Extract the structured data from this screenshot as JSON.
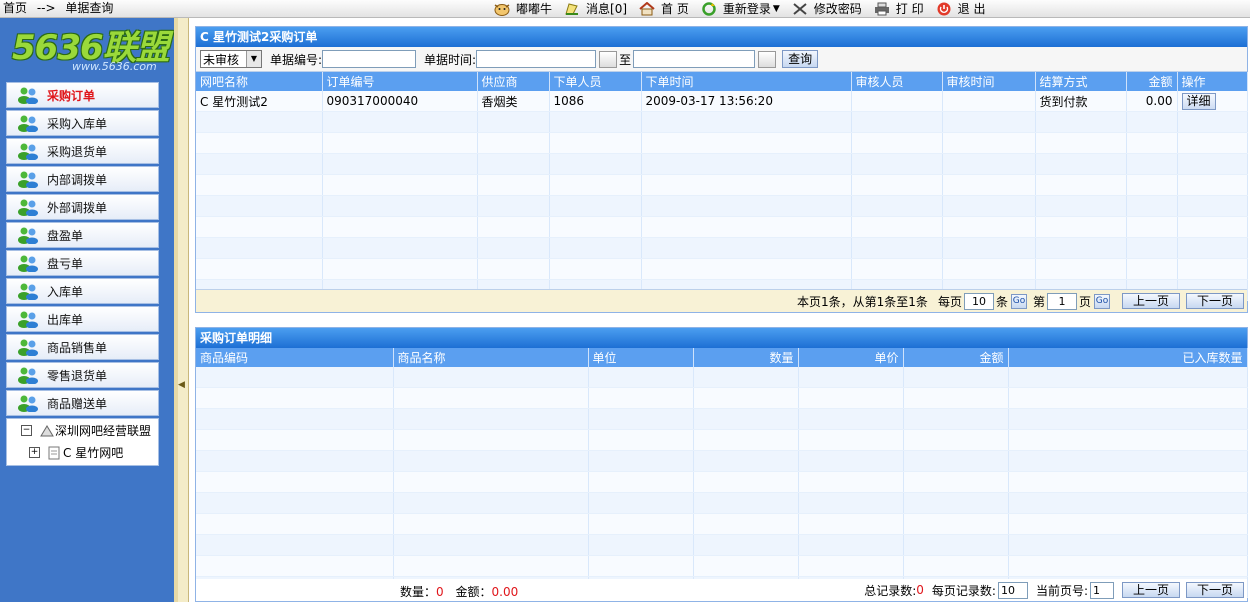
{
  "breadcrumb": {
    "home": "首页",
    "sep": "-->",
    "current": "单据查询"
  },
  "topnav": {
    "user": "嘟嘟牛",
    "messages": "消息[0]",
    "home": "首 页",
    "relogin": "重新登录",
    "change_password": "修改密码",
    "print": "打 印",
    "logout": "退 出"
  },
  "logo": {
    "text": "5636联盟",
    "url": "www.5636.com"
  },
  "sidebar": {
    "items": [
      {
        "label": "采购订单"
      },
      {
        "label": "采购入库单"
      },
      {
        "label": "采购退货单"
      },
      {
        "label": "内部调拨单"
      },
      {
        "label": "外部调拨单"
      },
      {
        "label": "盘盈单"
      },
      {
        "label": "盘亏单"
      },
      {
        "label": "入库单"
      },
      {
        "label": "出库单"
      },
      {
        "label": "商品销售单"
      },
      {
        "label": "零售退货单"
      },
      {
        "label": "商品赠送单"
      }
    ],
    "tree": {
      "root": "深圳网吧经营联盟",
      "child": "C 星竹网吧"
    }
  },
  "orders": {
    "title": "C 星竹测试2采购订单",
    "search": {
      "status": "未审核",
      "doc_no_label": "单据编号:",
      "doc_time_label": "单据时间:",
      "to_label": "至",
      "query_button": "查询"
    },
    "columns": [
      "网吧名称",
      "订单编号",
      "供应商",
      "下单人员",
      "下单时间",
      "审核人员",
      "审核时间",
      "结算方式",
      "金额",
      "操作"
    ],
    "rows": [
      {
        "cafe": "C 星竹测试2",
        "order_no": "090317000040",
        "supplier": "香烟类",
        "orderer": "1086",
        "order_time": "2009-03-17 13:56:20",
        "reviewer": "",
        "review_time": "",
        "settlement": "货到付款",
        "amount": "0.00",
        "action": "详细"
      }
    ],
    "pager": {
      "summary": "本页1条，从第1条至1条",
      "per_page_label": "每页",
      "per_page": "10",
      "unit": "条",
      "go": "Go",
      "page_prefix": "第",
      "page": "1",
      "page_suffix": "页",
      "go2": "Go",
      "prev": "上一页",
      "next": "下一页"
    }
  },
  "details": {
    "title": "采购订单明细",
    "columns": [
      "商品编码",
      "商品名称",
      "单位",
      "数量",
      "单价",
      "金额",
      "已入库数量"
    ],
    "footer": {
      "qty_label": "数量：",
      "qty": "0",
      "amount_label": "金额：",
      "amount": "0.00",
      "total_label": "总记录数:",
      "total": "0",
      "per_page_label": "每页记录数:",
      "per_page": "10",
      "page_label": "当前页号:",
      "page": "1",
      "prev": "上一页",
      "next": "下一页"
    }
  },
  "colors": {
    "accent": "#1d6fd4",
    "header": "#5b9ff0",
    "sidebar": "#3f76c7",
    "alert": "#e0161b"
  }
}
